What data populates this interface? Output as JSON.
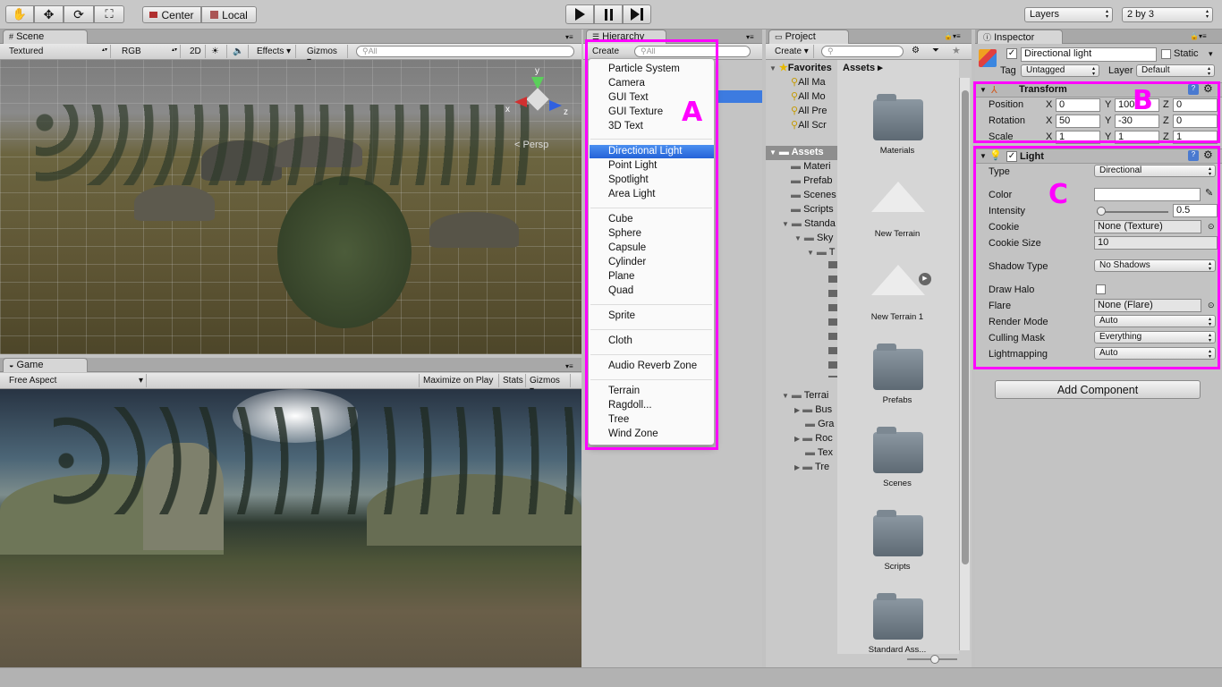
{
  "toolbar": {
    "pivot_center": "Center",
    "pivot_local": "Local",
    "layers": "Layers",
    "layout": "2 by 3",
    "play_icon": "play-icon",
    "pause_icon": "pause-icon",
    "step_icon": "step-icon"
  },
  "scene": {
    "tab": "Scene",
    "shading": "Textured",
    "render": "RGB",
    "mode_2d": "2D",
    "effects": "Effects",
    "gizmos": "Gizmos",
    "search_placeholder": "All",
    "persp_label": "Persp",
    "axis_x": "x",
    "axis_y": "y",
    "axis_z": "z"
  },
  "game": {
    "tab": "Game",
    "aspect": "Free Aspect",
    "maximize": "Maximize on Play",
    "stats": "Stats",
    "gizmos": "Gizmos"
  },
  "hierarchy": {
    "tab": "Hierarchy",
    "create": "Create",
    "search_placeholder": "All",
    "menu_groups": [
      [
        "Particle System",
        "Camera",
        "GUI Text",
        "GUI Texture",
        "3D Text"
      ],
      [
        "Directional Light",
        "Point Light",
        "Spotlight",
        "Area Light"
      ],
      [
        "Cube",
        "Sphere",
        "Capsule",
        "Cylinder",
        "Plane",
        "Quad"
      ],
      [
        "Sprite"
      ],
      [
        "Cloth"
      ],
      [
        "Audio Reverb Zone"
      ],
      [
        "Terrain",
        "Ragdoll...",
        "Tree",
        "Wind Zone"
      ]
    ],
    "selected": "Directional Light",
    "annotation": "A"
  },
  "project": {
    "tab": "Project",
    "create": "Create",
    "favorites_label": "Favorites",
    "favorites": [
      "All Ma",
      "All Mo",
      "All Pre",
      "All Scr"
    ],
    "assets_label": "Assets",
    "tree": [
      "Materi",
      "Prefab",
      "Scenes",
      "Scripts",
      "Standa",
      "Sky",
      "T",
      "Terrai",
      "Bus",
      "Gra",
      "Roc",
      "Tex",
      "Tre"
    ],
    "breadcrumb": "Assets",
    "assets": [
      "Materials",
      "New Terrain",
      "New Terrain 1",
      "Prefabs",
      "Scenes",
      "Scripts",
      "Standard Ass..."
    ]
  },
  "inspector": {
    "tab": "Inspector",
    "object_name": "Directional light",
    "static": "Static",
    "tag_label": "Tag",
    "tag": "Untagged",
    "layer_label": "Layer",
    "layer": "Default",
    "transform": {
      "title": "Transform",
      "position_label": "Position",
      "rotation_label": "Rotation",
      "scale_label": "Scale",
      "position": [
        "0",
        "100",
        "0"
      ],
      "rotation": [
        "50",
        "-30",
        "0"
      ],
      "scale": [
        "1",
        "1",
        "1"
      ],
      "x": "X",
      "y": "Y",
      "z": "Z"
    },
    "light": {
      "title": "Light",
      "type_label": "Type",
      "type": "Directional",
      "color_label": "Color",
      "intensity_label": "Intensity",
      "intensity": "0.5",
      "intensity_fraction": 0.06,
      "cookie_label": "Cookie",
      "cookie": "None (Texture)",
      "cookie_size_label": "Cookie Size",
      "cookie_size": "10",
      "shadow_label": "Shadow Type",
      "shadow": "No Shadows",
      "halo_label": "Draw Halo",
      "flare_label": "Flare",
      "flare": "None (Flare)",
      "render_label": "Render Mode",
      "render": "Auto",
      "culling_label": "Culling Mask",
      "culling": "Everything",
      "lightmap_label": "Lightmapping",
      "lightmap": "Auto"
    },
    "add_component": "Add Component",
    "annotation_b": "B",
    "annotation_c": "C"
  }
}
